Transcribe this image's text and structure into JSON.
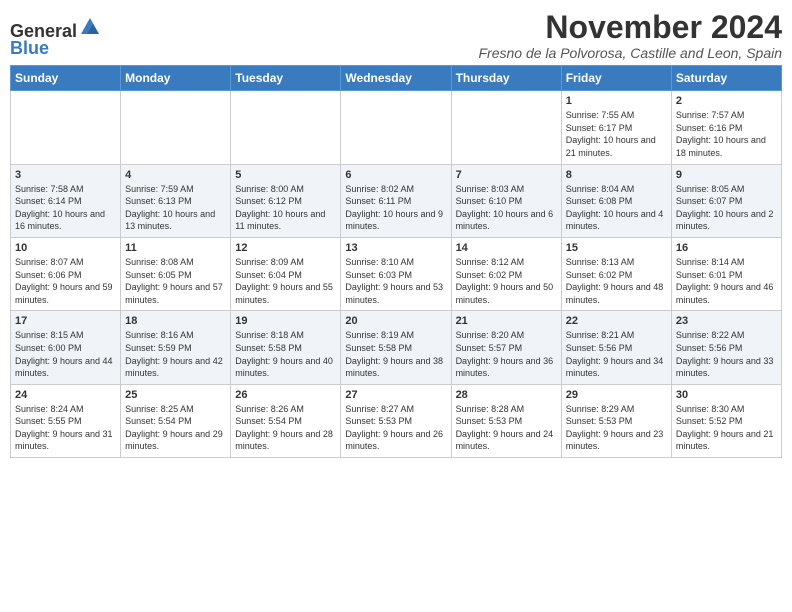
{
  "header": {
    "logo_general": "General",
    "logo_blue": "Blue",
    "month_title": "November 2024",
    "location": "Fresno de la Polvorosa, Castille and Leon, Spain"
  },
  "days_of_week": [
    "Sunday",
    "Monday",
    "Tuesday",
    "Wednesday",
    "Thursday",
    "Friday",
    "Saturday"
  ],
  "weeks": [
    [
      {
        "day": "",
        "info": ""
      },
      {
        "day": "",
        "info": ""
      },
      {
        "day": "",
        "info": ""
      },
      {
        "day": "",
        "info": ""
      },
      {
        "day": "",
        "info": ""
      },
      {
        "day": "1",
        "info": "Sunrise: 7:55 AM\nSunset: 6:17 PM\nDaylight: 10 hours and 21 minutes."
      },
      {
        "day": "2",
        "info": "Sunrise: 7:57 AM\nSunset: 6:16 PM\nDaylight: 10 hours and 18 minutes."
      }
    ],
    [
      {
        "day": "3",
        "info": "Sunrise: 7:58 AM\nSunset: 6:14 PM\nDaylight: 10 hours and 16 minutes."
      },
      {
        "day": "4",
        "info": "Sunrise: 7:59 AM\nSunset: 6:13 PM\nDaylight: 10 hours and 13 minutes."
      },
      {
        "day": "5",
        "info": "Sunrise: 8:00 AM\nSunset: 6:12 PM\nDaylight: 10 hours and 11 minutes."
      },
      {
        "day": "6",
        "info": "Sunrise: 8:02 AM\nSunset: 6:11 PM\nDaylight: 10 hours and 9 minutes."
      },
      {
        "day": "7",
        "info": "Sunrise: 8:03 AM\nSunset: 6:10 PM\nDaylight: 10 hours and 6 minutes."
      },
      {
        "day": "8",
        "info": "Sunrise: 8:04 AM\nSunset: 6:08 PM\nDaylight: 10 hours and 4 minutes."
      },
      {
        "day": "9",
        "info": "Sunrise: 8:05 AM\nSunset: 6:07 PM\nDaylight: 10 hours and 2 minutes."
      }
    ],
    [
      {
        "day": "10",
        "info": "Sunrise: 8:07 AM\nSunset: 6:06 PM\nDaylight: 9 hours and 59 minutes."
      },
      {
        "day": "11",
        "info": "Sunrise: 8:08 AM\nSunset: 6:05 PM\nDaylight: 9 hours and 57 minutes."
      },
      {
        "day": "12",
        "info": "Sunrise: 8:09 AM\nSunset: 6:04 PM\nDaylight: 9 hours and 55 minutes."
      },
      {
        "day": "13",
        "info": "Sunrise: 8:10 AM\nSunset: 6:03 PM\nDaylight: 9 hours and 53 minutes."
      },
      {
        "day": "14",
        "info": "Sunrise: 8:12 AM\nSunset: 6:02 PM\nDaylight: 9 hours and 50 minutes."
      },
      {
        "day": "15",
        "info": "Sunrise: 8:13 AM\nSunset: 6:02 PM\nDaylight: 9 hours and 48 minutes."
      },
      {
        "day": "16",
        "info": "Sunrise: 8:14 AM\nSunset: 6:01 PM\nDaylight: 9 hours and 46 minutes."
      }
    ],
    [
      {
        "day": "17",
        "info": "Sunrise: 8:15 AM\nSunset: 6:00 PM\nDaylight: 9 hours and 44 minutes."
      },
      {
        "day": "18",
        "info": "Sunrise: 8:16 AM\nSunset: 5:59 PM\nDaylight: 9 hours and 42 minutes."
      },
      {
        "day": "19",
        "info": "Sunrise: 8:18 AM\nSunset: 5:58 PM\nDaylight: 9 hours and 40 minutes."
      },
      {
        "day": "20",
        "info": "Sunrise: 8:19 AM\nSunset: 5:58 PM\nDaylight: 9 hours and 38 minutes."
      },
      {
        "day": "21",
        "info": "Sunrise: 8:20 AM\nSunset: 5:57 PM\nDaylight: 9 hours and 36 minutes."
      },
      {
        "day": "22",
        "info": "Sunrise: 8:21 AM\nSunset: 5:56 PM\nDaylight: 9 hours and 34 minutes."
      },
      {
        "day": "23",
        "info": "Sunrise: 8:22 AM\nSunset: 5:56 PM\nDaylight: 9 hours and 33 minutes."
      }
    ],
    [
      {
        "day": "24",
        "info": "Sunrise: 8:24 AM\nSunset: 5:55 PM\nDaylight: 9 hours and 31 minutes."
      },
      {
        "day": "25",
        "info": "Sunrise: 8:25 AM\nSunset: 5:54 PM\nDaylight: 9 hours and 29 minutes."
      },
      {
        "day": "26",
        "info": "Sunrise: 8:26 AM\nSunset: 5:54 PM\nDaylight: 9 hours and 28 minutes."
      },
      {
        "day": "27",
        "info": "Sunrise: 8:27 AM\nSunset: 5:53 PM\nDaylight: 9 hours and 26 minutes."
      },
      {
        "day": "28",
        "info": "Sunrise: 8:28 AM\nSunset: 5:53 PM\nDaylight: 9 hours and 24 minutes."
      },
      {
        "day": "29",
        "info": "Sunrise: 8:29 AM\nSunset: 5:53 PM\nDaylight: 9 hours and 23 minutes."
      },
      {
        "day": "30",
        "info": "Sunrise: 8:30 AM\nSunset: 5:52 PM\nDaylight: 9 hours and 21 minutes."
      }
    ]
  ]
}
